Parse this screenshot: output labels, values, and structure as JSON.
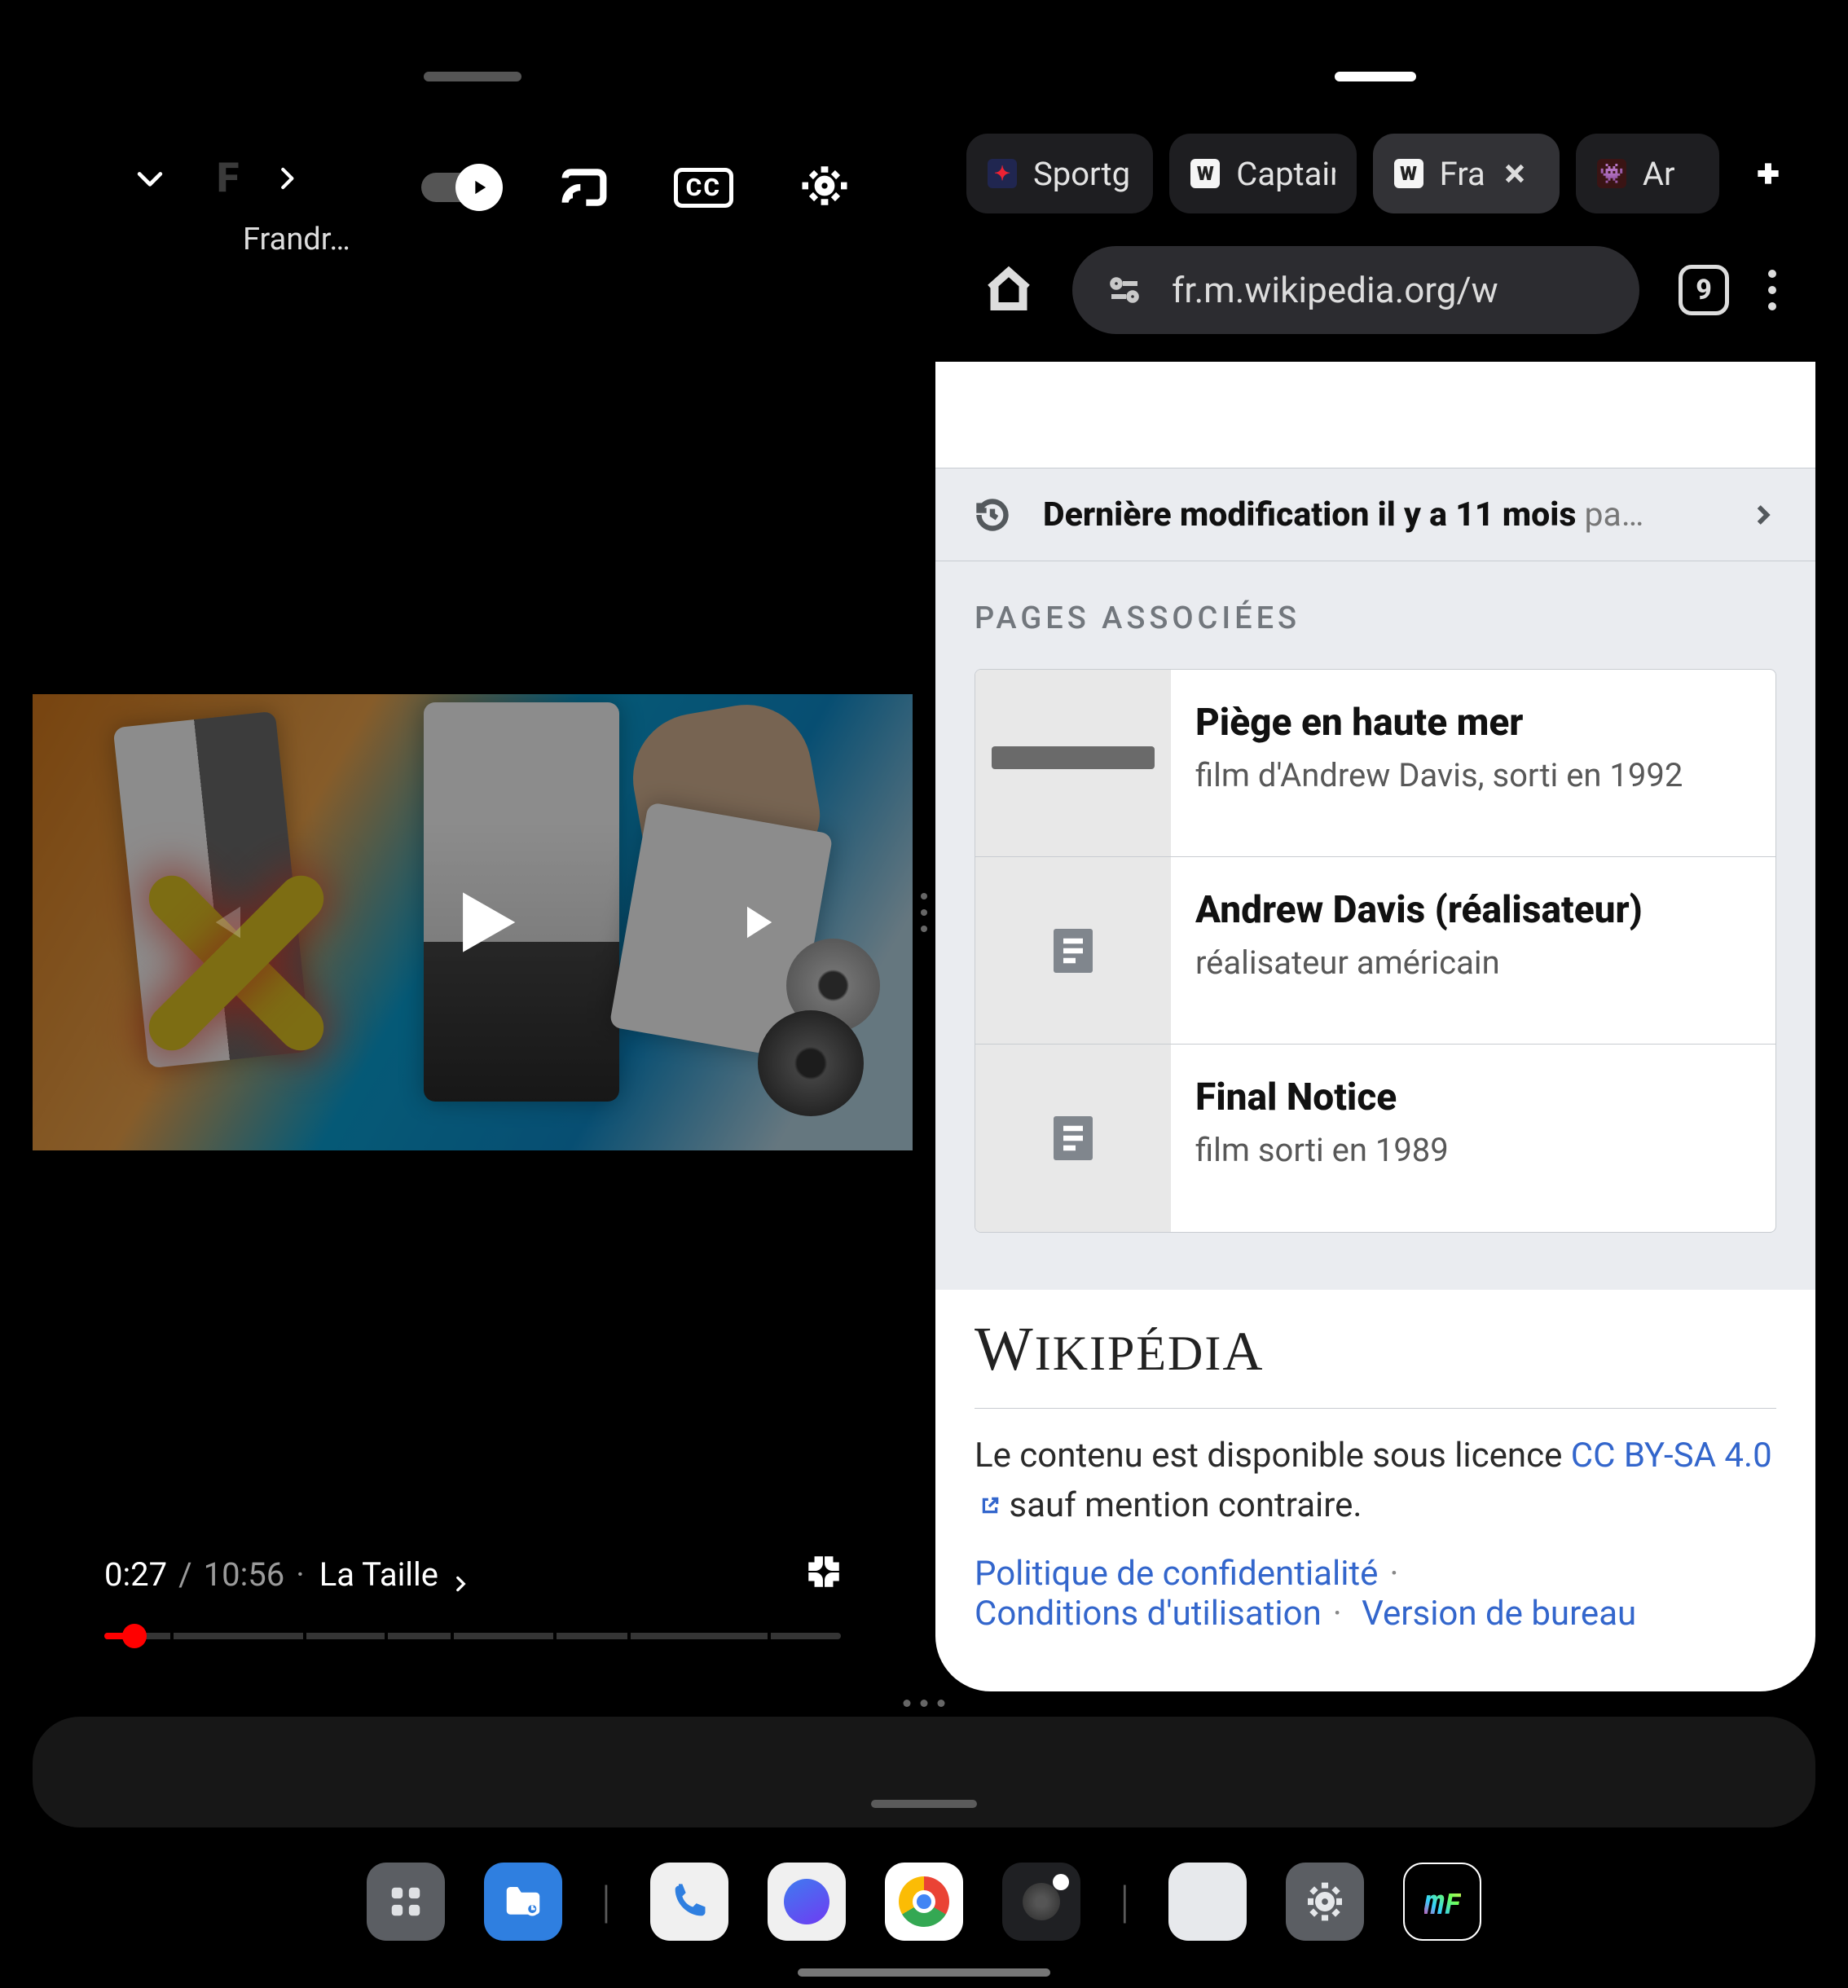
{
  "left_pane": {
    "channel_initial": "F",
    "channel_name": "Frandr…",
    "chapter_label": "La Taille",
    "current_time": "0:27",
    "duration": "10:56",
    "cc_label": "CC",
    "progress_pct": 4.1,
    "chapter_ticks_pct": [
      9,
      27,
      38,
      47,
      61,
      71,
      90
    ]
  },
  "right_pane": {
    "tabs": [
      {
        "label": "Sportg",
        "favicon_bg": "#202650",
        "favicon_fg": "#e23",
        "active": false
      },
      {
        "label": "Captain",
        "favicon_text": "W",
        "favicon_bg": "#f5f5f5",
        "active": false
      },
      {
        "label": "Fra",
        "favicon_text": "W",
        "favicon_bg": "#f5f5f5",
        "active": true
      },
      {
        "label": "Ar",
        "favicon_bg": "#3a1414",
        "favicon_emoji": "👾",
        "active": false
      }
    ],
    "url": "fr.m.wikipedia.org/w",
    "tab_count": "9",
    "last_mod": {
      "prefix": "Dernière modification il y a 11 mois",
      "by": " pa…"
    },
    "related_header": "PAGES ASSOCIÉES",
    "cards": [
      {
        "title": "Piège en haute mer",
        "desc": "film d'Andrew Davis, sorti en 1992",
        "thumb": "ship"
      },
      {
        "title": "Andrew Davis (réalisateur)",
        "desc": "réalisateur américain",
        "thumb": "doc"
      },
      {
        "title": "Final Notice",
        "desc": "film sorti en 1989",
        "thumb": "doc"
      }
    ],
    "footer": {
      "logo": "WikipédiA",
      "license_pre": "Le contenu est disponible sous licence ",
      "license_link": "CC BY-SA 4.0",
      "license_post": " sauf mention contraire.",
      "links": [
        "Politique de confidentialité",
        "Conditions d'utilisation",
        "Version de bureau"
      ]
    }
  },
  "taskbar": {
    "apps": [
      "grid",
      "files",
      "sep",
      "phone",
      "messages",
      "chrome",
      "camera",
      "sep",
      "google",
      "settings",
      "frandroid"
    ]
  }
}
